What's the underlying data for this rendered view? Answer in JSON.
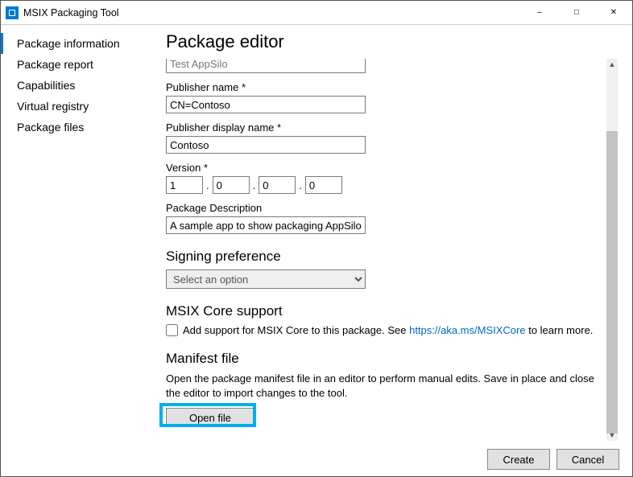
{
  "window": {
    "title": "MSIX Packaging Tool"
  },
  "sidebar": {
    "items": [
      {
        "label": "Package information",
        "active": true
      },
      {
        "label": "Package report"
      },
      {
        "label": "Capabilities"
      },
      {
        "label": "Virtual registry"
      },
      {
        "label": "Package files"
      }
    ]
  },
  "main": {
    "heading": "Package editor",
    "truncated_field_value": "Test AppSilo",
    "publisher_name": {
      "label": "Publisher name *",
      "value": "CN=Contoso"
    },
    "publisher_display": {
      "label": "Publisher display name *",
      "value": "Contoso"
    },
    "version": {
      "label": "Version *",
      "parts": [
        "1",
        "0",
        "0",
        "0"
      ]
    },
    "package_desc": {
      "label": "Package Description",
      "value": "A sample app to show packaging AppSilo"
    },
    "signing": {
      "heading": "Signing preference",
      "selected": "Select an option"
    },
    "msix_core": {
      "heading": "MSIX Core support",
      "checkbox_label_pre": "Add support for MSIX Core to this package. See ",
      "link_text": "https://aka.ms/MSIXCore",
      "checkbox_label_post": " to learn more."
    },
    "manifest": {
      "heading": "Manifest file",
      "desc": "Open the package manifest file in an editor to perform manual edits. Save in place and close the editor to import changes to the tool.",
      "button": "Open file"
    }
  },
  "footer": {
    "create": "Create",
    "cancel": "Cancel"
  }
}
